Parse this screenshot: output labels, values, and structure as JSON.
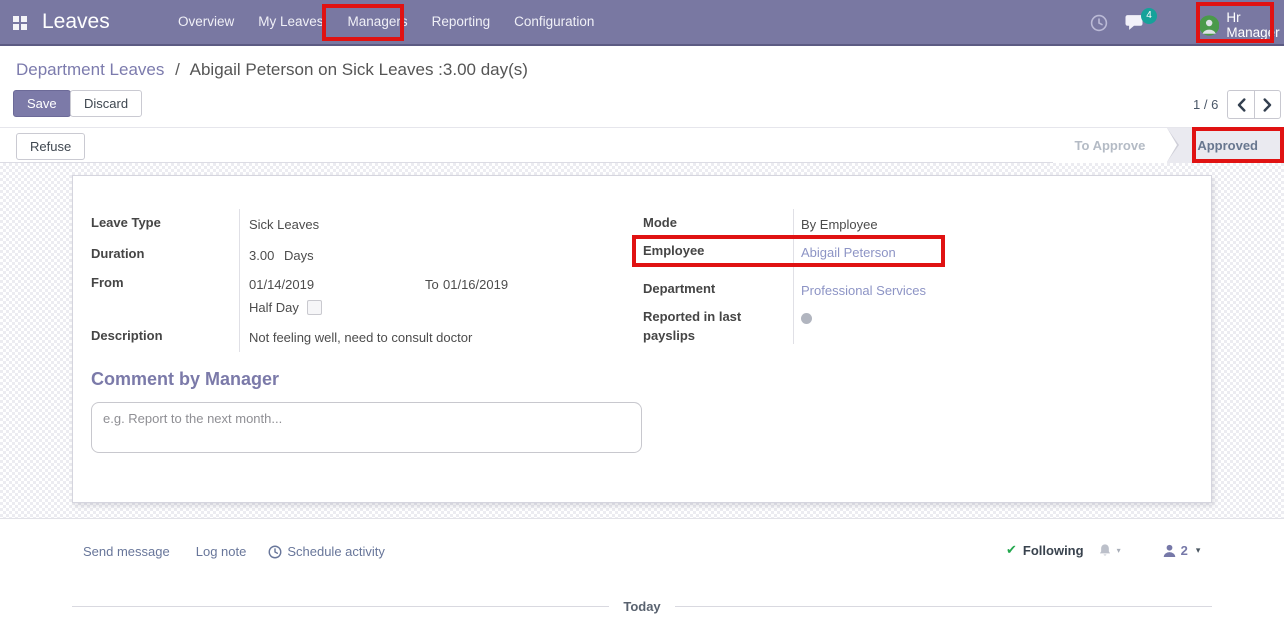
{
  "nav": {
    "app_name": "Leaves",
    "menu": [
      {
        "label": "Overview"
      },
      {
        "label": "My Leaves"
      },
      {
        "label": "Managers"
      },
      {
        "label": "Reporting"
      },
      {
        "label": "Configuration"
      }
    ],
    "messages_badge": "4",
    "user_name": "Hr Manager"
  },
  "control_panel": {
    "breadcrumb_parent": "Department Leaves",
    "breadcrumb_separator": "/",
    "breadcrumb_current": "Abigail Peterson on Sick Leaves :3.00 day(s)",
    "save_label": "Save",
    "discard_label": "Discard",
    "pager_value": "1 / 6"
  },
  "statusbar": {
    "refuse_label": "Refuse",
    "steps": [
      {
        "label": "To Approve",
        "active": false
      },
      {
        "label": "Approved",
        "active": true
      }
    ]
  },
  "form": {
    "leave_type": {
      "label": "Leave Type",
      "value": "Sick Leaves"
    },
    "duration": {
      "label": "Duration",
      "value": "3.00",
      "unit": "Days"
    },
    "from": {
      "label": "From",
      "date_from": "01/14/2019",
      "to_label": "To",
      "date_to": "01/16/2019"
    },
    "half_day": {
      "label": "Half Day",
      "checked": false
    },
    "description": {
      "label": "Description",
      "value": "Not feeling well, need to consult doctor"
    },
    "mode": {
      "label": "Mode",
      "value": "By Employee"
    },
    "employee": {
      "label": "Employee",
      "value": "Abigail Peterson"
    },
    "department": {
      "label": "Department",
      "value": "Professional Services"
    },
    "payslips": {
      "label": "Reported in last payslips"
    }
  },
  "comment": {
    "title": "Comment by Manager",
    "placeholder": "e.g. Report to the next month..."
  },
  "chatter": {
    "send_message": "Send message",
    "log_note": "Log note",
    "schedule_activity": "Schedule activity",
    "following": "Following",
    "followers_count": "2",
    "today_label": "Today"
  },
  "icons": {
    "navbar": [
      "apps-grid-icon",
      "activity-clock-icon",
      "messages-icon",
      "user-avatar"
    ],
    "chatter": [
      "schedule-clock-icon",
      "check-icon",
      "bell-icon",
      "followers-person-icon"
    ]
  },
  "colors": {
    "navbar_bg": "#7978a2",
    "primary_purple": "#7c7aa8",
    "breadcrumb_link": "#7c7bad",
    "record_link": "#8d94c5",
    "highlight_red": "#e01212",
    "badge_teal": "#16a29a",
    "avatar_green": "#4a9a4a",
    "following_green": "#23a84e",
    "status_active_bg": "#eaeaf0"
  }
}
